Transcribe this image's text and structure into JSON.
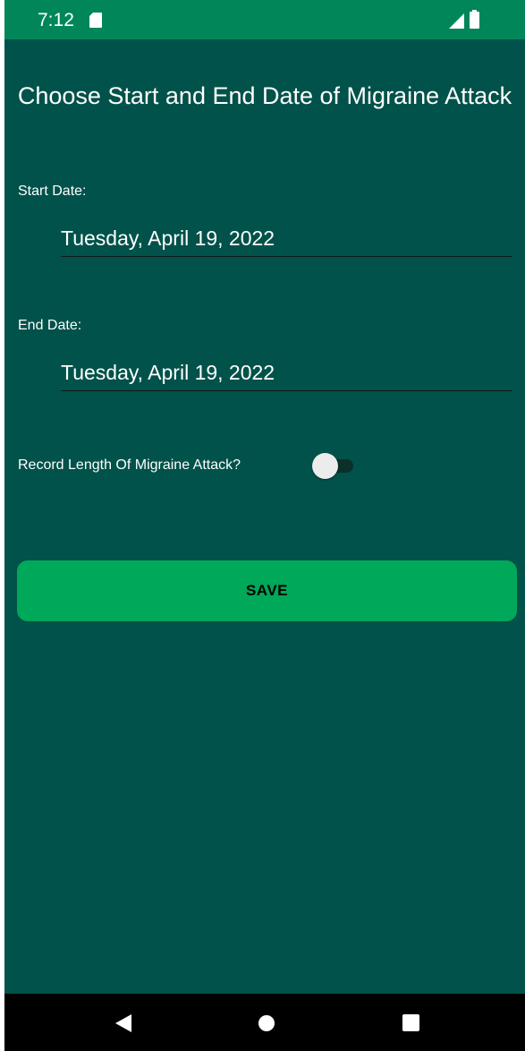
{
  "status_bar": {
    "time": "7:12",
    "icons": [
      "sd-card-icon",
      "signal-icon",
      "battery-icon"
    ]
  },
  "page": {
    "title": "Choose Start and End Date of Migraine Attack"
  },
  "start": {
    "label": "Start Date:",
    "value": "Tuesday, April 19, 2022"
  },
  "end": {
    "label": "End Date:",
    "value": "Tuesday, April 19, 2022"
  },
  "record_length": {
    "label": "Record Length Of Migraine Attack?",
    "enabled": false
  },
  "save": {
    "label": "SAVE"
  },
  "nav": {
    "icons": [
      "back-icon",
      "home-icon",
      "recents-icon"
    ]
  },
  "colors": {
    "background": "#00524a",
    "status_bar": "#008659",
    "button": "#00a85a",
    "nav_bar": "#000000"
  }
}
